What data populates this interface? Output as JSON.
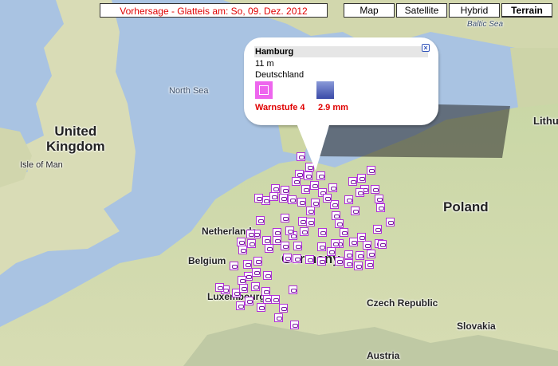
{
  "title": "Vorhersage - Glatteis am: So, 09. Dez. 2012",
  "map_types": [
    {
      "label": "Map",
      "active": false
    },
    {
      "label": "Satellite",
      "active": false
    },
    {
      "label": "Hybrid",
      "active": false
    },
    {
      "label": "Terrain",
      "active": true
    }
  ],
  "map_labels": {
    "united_kingdom": "United\nKingdom",
    "isle_of_man": "Isle of Man",
    "north_sea": "North Sea",
    "baltic_sea": "Baltic Sea",
    "netherlands": "Netherlands",
    "belgium": "Belgium",
    "luxembourg": "Luxembourg",
    "germany": "Germany",
    "poland": "Poland",
    "lithuania": "Lithu",
    "czech_republic": "Czech Republic",
    "slovakia": "Slovakia",
    "austria": "Austria"
  },
  "popup": {
    "station": "Hamburg",
    "elevation": "11 m",
    "country": "Deutschland",
    "warning": "Warnstufe 4",
    "precip": "2.9  mm"
  },
  "colors": {
    "title_text": "#e00000",
    "marker_border": "#b030d8",
    "warning_icon": "#ee66ee"
  }
}
